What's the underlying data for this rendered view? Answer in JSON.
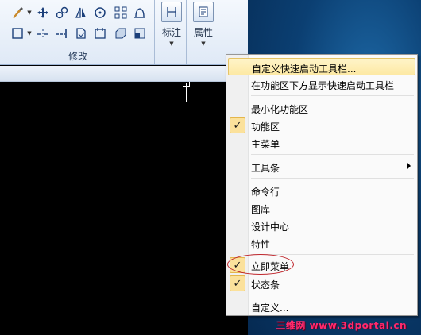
{
  "ribbon": {
    "group_label": "修改",
    "annotate_label": "标注",
    "properties_label": "属性",
    "tools_row1": [
      "brush-icon",
      "move-icon",
      "copy-icon",
      "mirror-icon",
      "rotate-icon",
      "array-icon",
      "stretch-icon"
    ],
    "tools_row2": [
      "rectangle-icon",
      "trim-icon",
      "extend-icon",
      "offset-icon",
      "break-icon",
      "chamfer-icon",
      "fillet-icon"
    ]
  },
  "menu": {
    "items": [
      {
        "label": "自定义快速启动工具栏...",
        "checked": false,
        "highlight": true
      },
      {
        "label": "在功能区下方显示快速启动工具栏",
        "checked": false
      },
      {
        "label": "最小化功能区",
        "checked": false
      },
      {
        "label": "功能区",
        "checked": true
      },
      {
        "label": "主菜单",
        "checked": false
      },
      {
        "label": "工具条",
        "checked": false,
        "submenu": true
      },
      {
        "label": "命令行",
        "checked": false
      },
      {
        "label": "图库",
        "checked": false
      },
      {
        "label": "设计中心",
        "checked": false
      },
      {
        "label": "特性",
        "checked": false
      },
      {
        "label": "立即菜单",
        "checked": true
      },
      {
        "label": "状态条",
        "checked": true
      },
      {
        "label": "自定义...",
        "checked": false
      }
    ],
    "check_glyph": "✓"
  },
  "watermark": "三维网 www.3dportal.cn",
  "colors": {
    "highlight": "#fde9a4",
    "check_bg": "#fbe19b",
    "annotation_ellipse": "#c0272d",
    "desktop_blue": "#0b3f72"
  }
}
